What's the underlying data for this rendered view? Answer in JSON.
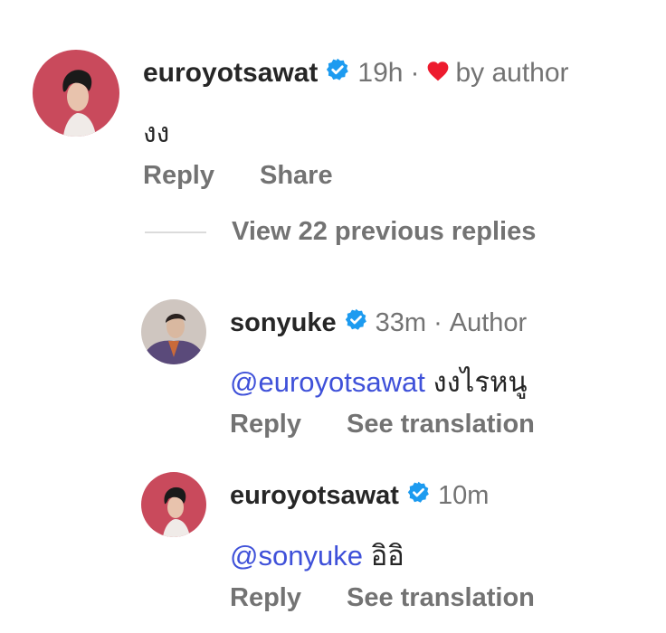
{
  "comments": [
    {
      "username": "euroyotsawat",
      "time": "19h",
      "separator": "·",
      "liked_by_author": "by author",
      "mention": "",
      "text": "งง",
      "actions": [
        "Reply",
        "Share"
      ]
    },
    {
      "username": "sonyuke",
      "time": "33m",
      "separator": "·",
      "role": "Author",
      "mention": "@euroyotsawat",
      "text": "งงไรหนู",
      "actions": [
        "Reply",
        "See translation"
      ]
    },
    {
      "username": "euroyotsawat",
      "time": "10m",
      "mention": "@sonyuke",
      "text": "อิอิ",
      "actions": [
        "Reply",
        "See translation"
      ]
    }
  ],
  "view_replies": "View 22 previous replies",
  "colors": {
    "verified": "#1d9bf0",
    "heart": "#ed1b2e",
    "mention": "#3f51d9",
    "muted": "#737373"
  }
}
